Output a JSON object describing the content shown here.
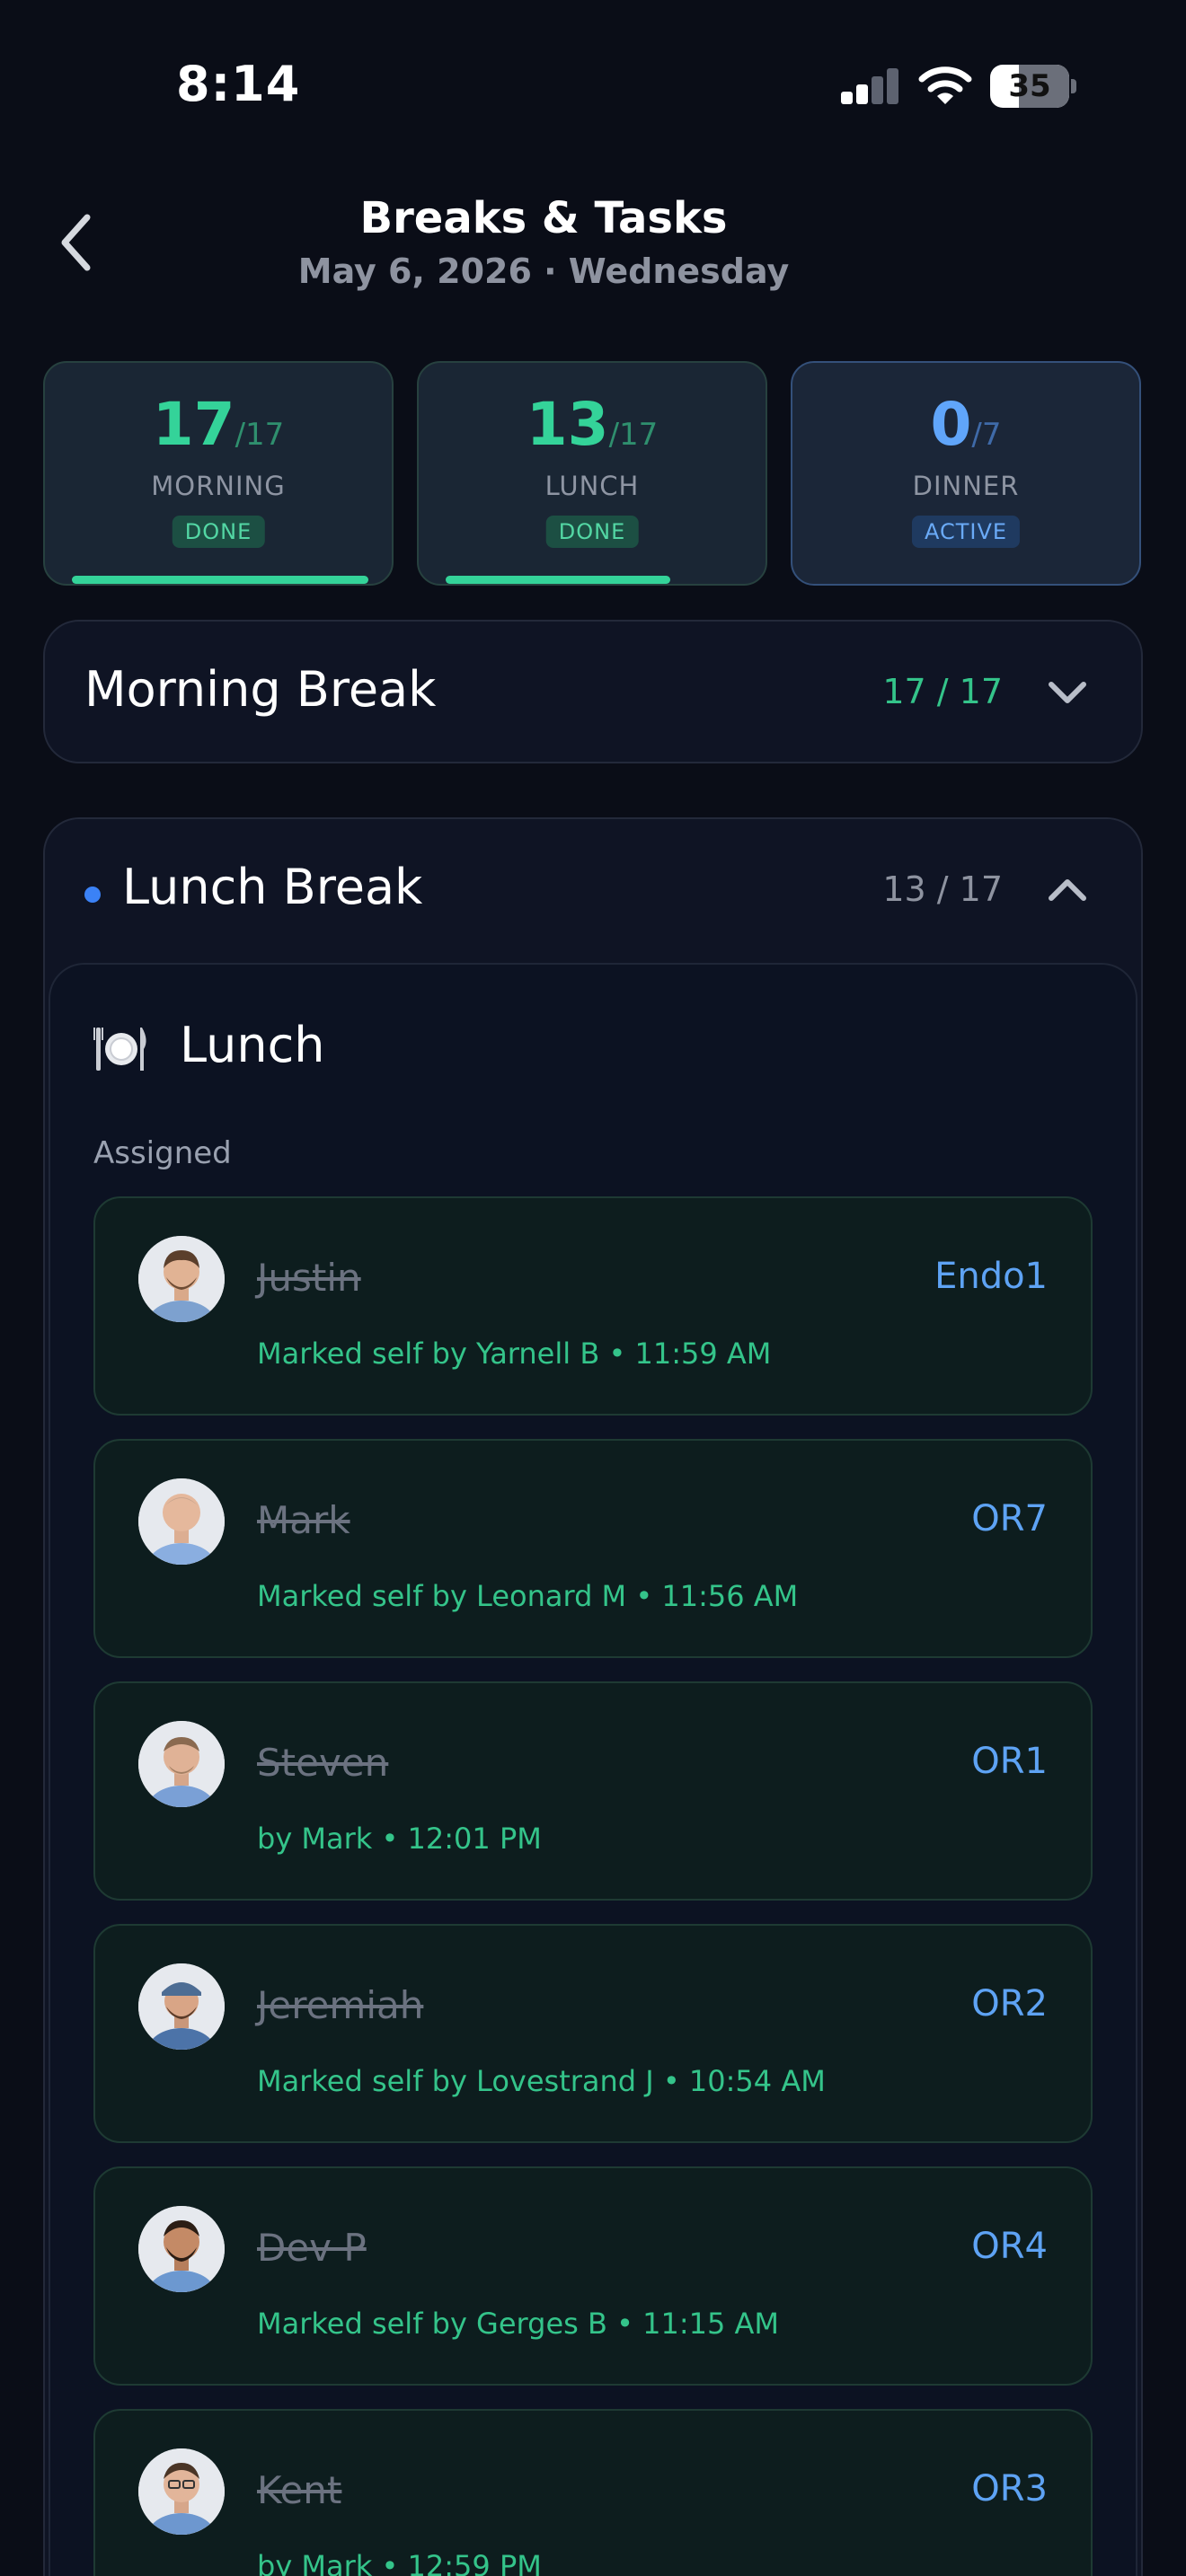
{
  "status_bar": {
    "time": "8:14",
    "battery": "35"
  },
  "header": {
    "title": "Breaks & Tasks",
    "subtitle": "May 6, 2026 · Wednesday"
  },
  "summary": [
    {
      "count": "17",
      "total": "/17",
      "label": "MORNING",
      "badge": "DONE",
      "progress": 1.0,
      "state": "done"
    },
    {
      "count": "13",
      "total": "/17",
      "label": "LUNCH",
      "badge": "DONE",
      "progress": 0.76,
      "state": "done"
    },
    {
      "count": "0",
      "total": "/7",
      "label": "DINNER",
      "badge": "ACTIVE",
      "progress": 0.0,
      "state": "active"
    }
  ],
  "morning_section": {
    "title": "Morning Break",
    "count": "17 / 17"
  },
  "lunch_section": {
    "title": "Lunch Break",
    "count": "13 / 17",
    "group_title": "Lunch",
    "assigned_label": "Assigned",
    "people": [
      {
        "name": "Justin",
        "room": "Endo1",
        "note": "Marked self by Yarnell B • 11:59 AM"
      },
      {
        "name": "Mark",
        "room": "OR7",
        "note": "Marked self by Leonard M • 11:56 AM"
      },
      {
        "name": "Steven",
        "room": "OR1",
        "note": "by Mark • 12:01 PM"
      },
      {
        "name": "Jeremiah",
        "room": "OR2",
        "note": "Marked self by Lovestrand J • 10:54 AM"
      },
      {
        "name": "Dev P",
        "room": "OR4",
        "note": "Marked self by Gerges B • 11:15 AM"
      },
      {
        "name": "Kent",
        "room": "OR3",
        "note": "by Mark • 12:59 PM"
      }
    ]
  },
  "colors": {
    "done_green": "#34d399",
    "active_blue": "#60a5fa",
    "background": "#0a0d17"
  }
}
